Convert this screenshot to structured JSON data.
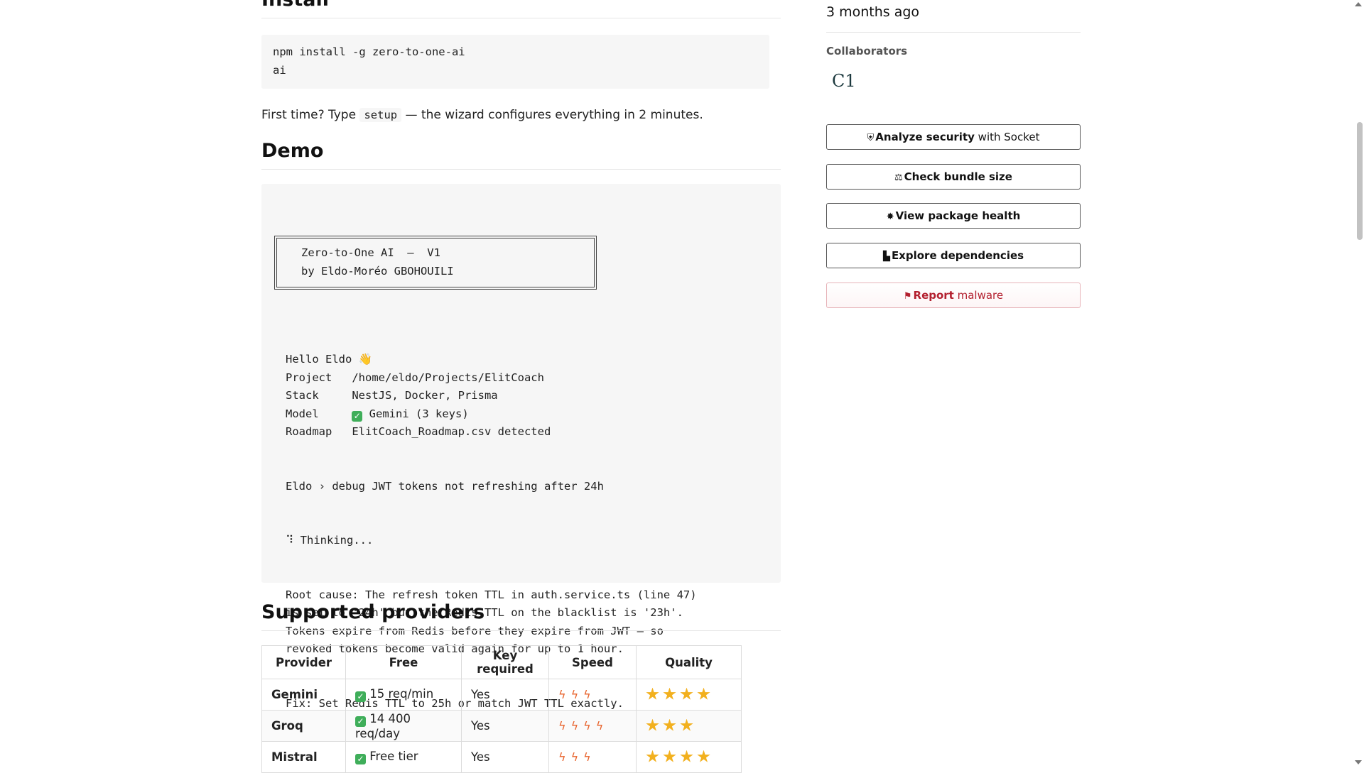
{
  "readme": {
    "install_heading": "Install",
    "install_code": "npm install -g zero-to-one-ai\nai",
    "first_time_prefix": "First time? Type",
    "first_time_code": "setup",
    "first_time_suffix": "— the wizard configures everything in 2 minutes.",
    "demo_heading": "Demo",
    "banner_line1": "Zero-to-One AI  —  V1",
    "banner_line2": "by Eldo-Moréo GBOHOUILI",
    "demo": {
      "hello": "Hello Eldo 👋",
      "project_label": "Project ",
      "project_value": "/home/eldo/Projects/ElitCoach",
      "stack_label": "Stack   ",
      "stack_value": "NestJS, Docker, Prisma",
      "model_label": "Model   ",
      "model_value": "Gemini (3 keys)",
      "roadmap_label": "Roadmap ",
      "roadmap_value": "ElitCoach_Roadmap.csv detected",
      "prompt": "Eldo › debug JWT tokens not refreshing after 24h",
      "thinking": "⠹ Thinking...",
      "root_cause": "Root cause: The refresh token TTL in auth.service.ts (line 47)\nis set to '24h' but the Redis TTL on the blacklist is '23h'.\nTokens expire from Redis before they expire from JWT — so\nrevoked tokens become valid again for up to 1 hour.",
      "fix": "Fix: Set Redis TTL to 25h or match JWT TTL exactly."
    },
    "providers_heading": "Supported providers",
    "table": {
      "headers": [
        "Provider",
        "Free",
        "Key required",
        "Speed",
        "Quality"
      ],
      "rows": [
        {
          "provider": "Gemini",
          "free": "15 req/min",
          "key": "Yes",
          "speed": 3,
          "quality": 4
        },
        {
          "provider": "Groq",
          "free": "14 400 req/day",
          "key": "Yes",
          "speed": 4,
          "quality": 3
        },
        {
          "provider": "Mistral",
          "free": "Free tier",
          "key": "Yes",
          "speed": 3,
          "quality": 4
        }
      ]
    }
  },
  "sidebar": {
    "last_publish": "3 months ago",
    "collaborators_label": "Collaborators",
    "avatar_text": "C1",
    "buttons": {
      "analyze_bold": "Analyze security",
      "analyze_rest": " with Socket",
      "bundle": "Check bundle size",
      "health": "View package health",
      "deps": "Explore dependencies",
      "report_bold": "Report",
      "report_rest": " malware"
    }
  },
  "colors": {
    "accent_report": "#b3202f",
    "check_green": "#3fae5a",
    "bolt": "#e8632c",
    "star": "#f2b01e"
  }
}
